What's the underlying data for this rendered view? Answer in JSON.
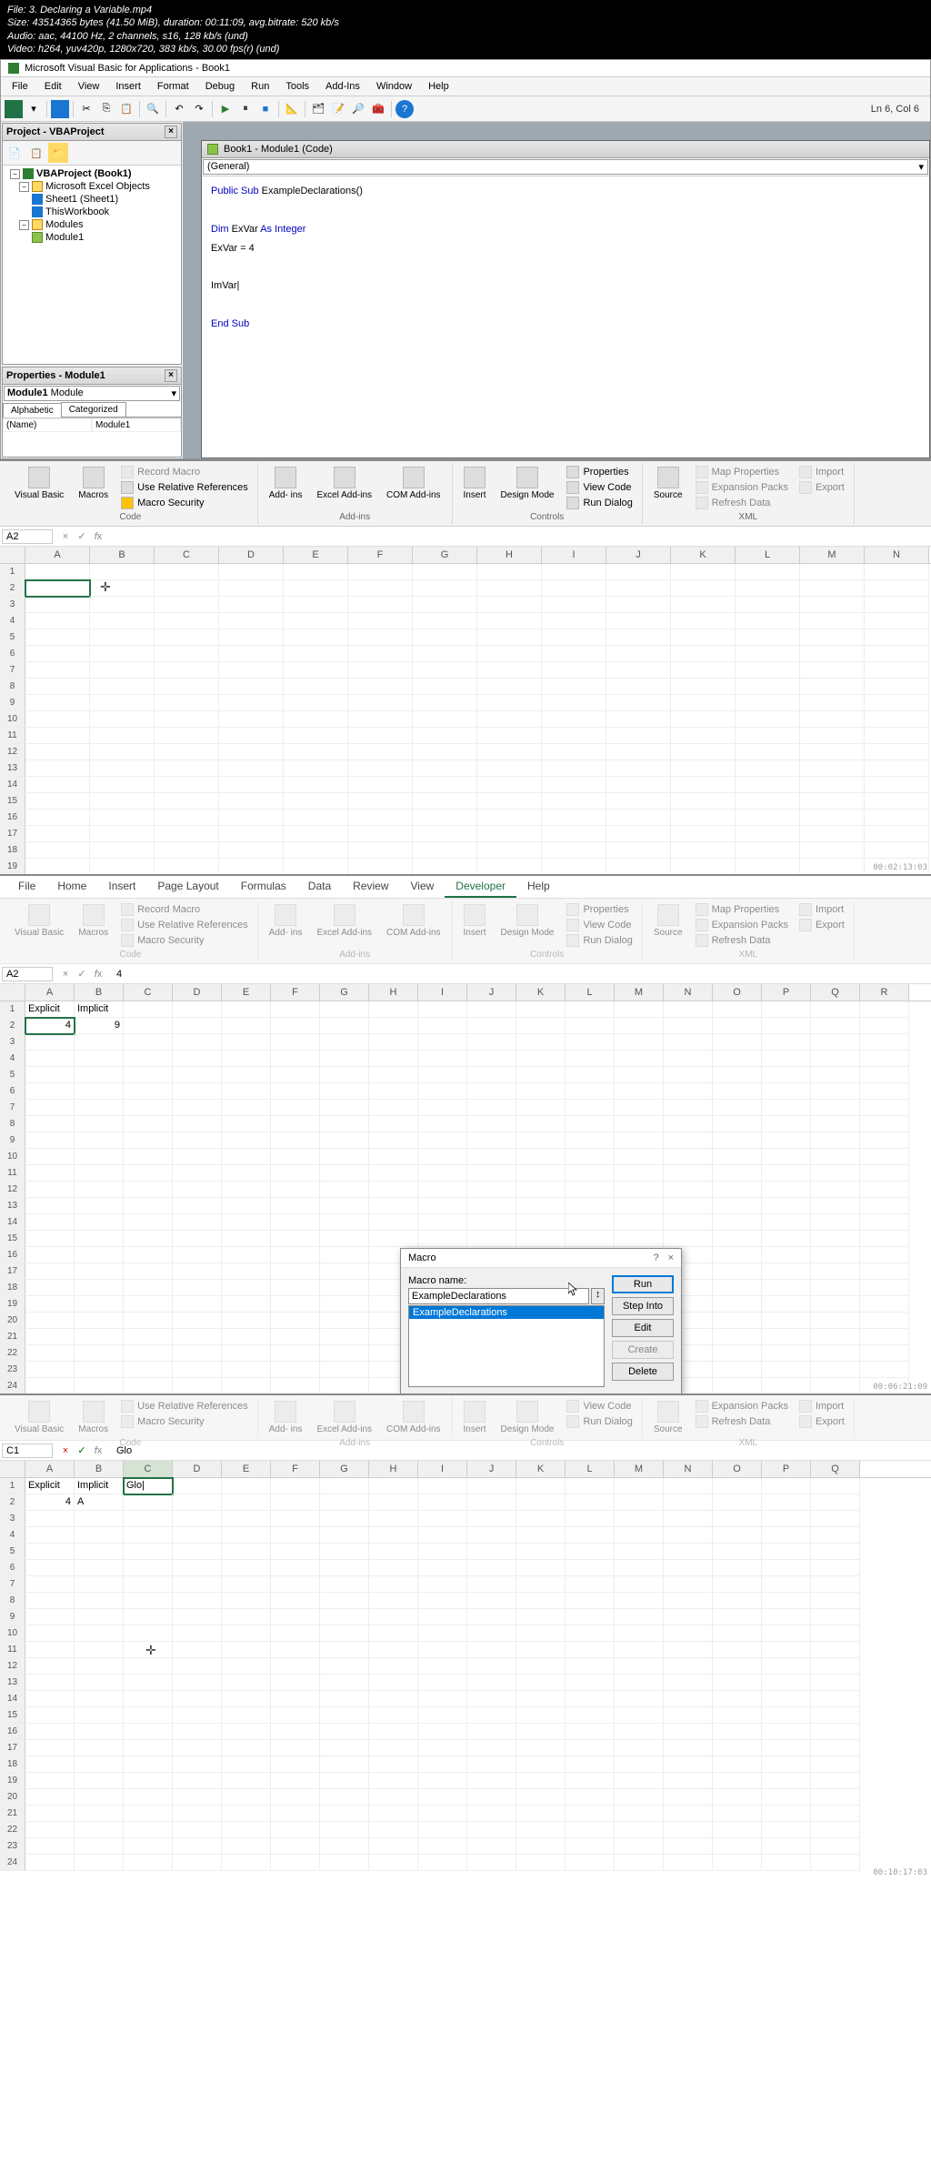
{
  "file_info": {
    "file": "File: 3. Declaring a Variable.mp4",
    "size": "Size: 43514365 bytes (41.50 MiB), duration: 00:11:09, avg.bitrate: 520 kb/s",
    "audio": "Audio: aac, 44100 Hz, 2 channels, s16, 128 kb/s (und)",
    "video": "Video: h264, yuv420p, 1280x720, 383 kb/s, 30.00 fps(r) (und)"
  },
  "vba": {
    "title": "Microsoft Visual Basic for Applications - Book1",
    "menu": [
      "File",
      "Edit",
      "View",
      "Insert",
      "Format",
      "Debug",
      "Run",
      "Tools",
      "Add-Ins",
      "Window",
      "Help"
    ],
    "status": "Ln 6, Col 6",
    "project_panel_title": "Project - VBAProject",
    "tree": {
      "root": "VBAProject (Book1)",
      "excel_objects": "Microsoft Excel Objects",
      "sheet1": "Sheet1 (Sheet1)",
      "thisworkbook": "ThisWorkbook",
      "modules": "Modules",
      "module1": "Module1"
    },
    "props_title": "Properties - Module1",
    "props_combo": "Module1 Module",
    "props_tabs": {
      "alphabetic": "Alphabetic",
      "categorized": "Categorized"
    },
    "props_name_key": "(Name)",
    "props_name_val": "Module1",
    "code_title": "Book1 - Module1 (Code)",
    "code_combo_left": "(General)",
    "code": {
      "l1a": "Public Sub",
      "l1b": " ExampleDeclarations()",
      "l2a": "Dim",
      "l2b": " ExVar ",
      "l2c": "As Integer",
      "l3": "ExVar = 4",
      "l4": "ImVar|",
      "l5": "End Sub"
    }
  },
  "excel1": {
    "ribbon_groups": {
      "code": "Code",
      "addins": "Add-ins",
      "controls": "Controls",
      "xml": "XML"
    },
    "buttons": {
      "visual_basic": "Visual\nBasic",
      "macros": "Macros",
      "record_macro": "Record Macro",
      "use_relative": "Use Relative References",
      "macro_security": "Macro Security",
      "addins": "Add-\nins",
      "excel_addins": "Excel\nAdd-ins",
      "com_addins": "COM\nAdd-ins",
      "insert": "Insert",
      "design_mode": "Design\nMode",
      "properties": "Properties",
      "view_code": "View Code",
      "run_dialog": "Run Dialog",
      "source": "Source",
      "map_properties": "Map Properties",
      "expansion_packs": "Expansion Packs",
      "refresh_data": "Refresh Data",
      "import": "Import",
      "export": "Export"
    },
    "namebox": "A2",
    "cols": [
      "A",
      "B",
      "C",
      "D",
      "E",
      "F",
      "G",
      "H",
      "I",
      "J",
      "K",
      "L",
      "M",
      "N"
    ],
    "timestamp": "00:02:13:03"
  },
  "excel2": {
    "tabs": [
      "File",
      "Home",
      "Insert",
      "Page Layout",
      "Formulas",
      "Data",
      "Review",
      "View",
      "Developer",
      "Help"
    ],
    "active_tab": "Developer",
    "namebox": "A2",
    "formula": "4",
    "cols": [
      "A",
      "B",
      "C",
      "D",
      "E",
      "F",
      "G",
      "H",
      "I",
      "J",
      "K",
      "L",
      "M",
      "N",
      "O",
      "P",
      "Q",
      "R"
    ],
    "row1": {
      "a": "Explicit",
      "b": "Implicit"
    },
    "row2": {
      "a": "4",
      "b": "9"
    },
    "macro_dialog": {
      "title": "Macro",
      "name_label": "Macro name:",
      "name_value": "ExampleDeclarations",
      "list_item": "ExampleDeclarations",
      "buttons": {
        "run": "Run",
        "step": "Step Into",
        "edit": "Edit",
        "create": "Create",
        "delete": "Delete"
      }
    },
    "timestamp": "00:06:21:09"
  },
  "excel3": {
    "namebox": "C1",
    "formula": "Glo",
    "cols": [
      "A",
      "B",
      "C",
      "D",
      "E",
      "F",
      "G",
      "H",
      "I",
      "J",
      "K",
      "L",
      "M",
      "N",
      "O",
      "P",
      "Q"
    ],
    "row1": {
      "a": "Explicit",
      "b": "Implicit",
      "c": "Glo|"
    },
    "row2": {
      "a": "4",
      "b": "A"
    },
    "timestamp": "00:10:17:03"
  }
}
